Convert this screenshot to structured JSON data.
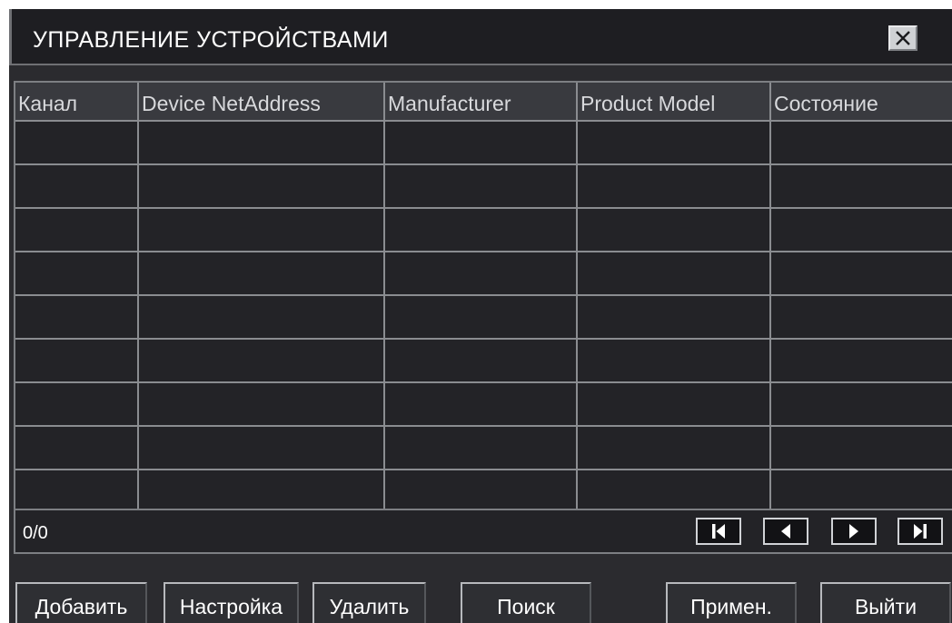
{
  "window": {
    "title": "УПРАВЛЕНИЕ УСТРОЙСТВАМИ",
    "close_icon": "close-x-icon"
  },
  "table": {
    "columns": [
      "Канал",
      "Device NetAddress",
      "Manufacturer",
      "Product Model",
      "Состояние"
    ],
    "rows": [
      [
        "",
        "",
        "",
        "",
        ""
      ],
      [
        "",
        "",
        "",
        "",
        ""
      ],
      [
        "",
        "",
        "",
        "",
        ""
      ],
      [
        "",
        "",
        "",
        "",
        ""
      ],
      [
        "",
        "",
        "",
        "",
        ""
      ],
      [
        "",
        "",
        "",
        "",
        ""
      ],
      [
        "",
        "",
        "",
        "",
        ""
      ],
      [
        "",
        "",
        "",
        "",
        ""
      ],
      [
        "",
        "",
        "",
        "",
        ""
      ]
    ]
  },
  "pager": {
    "count": "0/0",
    "buttons": [
      "first-page-icon",
      "previous-page-icon",
      "next-page-icon",
      "last-page-icon"
    ]
  },
  "actions": {
    "add": "Добавить",
    "settings": "Настройка",
    "delete": "Удалить",
    "search": "Поиск",
    "apply": "Примен.",
    "exit": "Выйти"
  },
  "colors": {
    "panel": "#2b2b2f",
    "cell": "#232327",
    "grid_line": "#8a8c90",
    "text": "#ffffff"
  }
}
